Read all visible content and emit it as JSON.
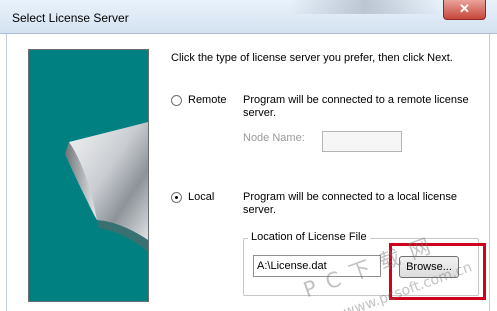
{
  "window": {
    "title": "Select License Server",
    "close_glyph": "✕"
  },
  "instruction": "Click the type of license server you prefer, then click Next.",
  "remote": {
    "label": "Remote",
    "checked": false,
    "description": "Program will be connected to a remote license server."
  },
  "node_name": {
    "label": "Node Name:",
    "value": ""
  },
  "local": {
    "label": "Local",
    "checked": true,
    "description": "Program will be connected to a local license server."
  },
  "license_file": {
    "group_label": "Location of License File",
    "value": "A:\\License.dat",
    "browse_label": "Browse..."
  },
  "watermark": {
    "title": "P C 下 载 网",
    "url": "www.pcsoft.com.cn"
  },
  "colors": {
    "side_panel": "#008080",
    "highlight": "#d0021b"
  },
  "icons": {
    "close": "close-icon",
    "page_curl": "page-curl-graphic"
  }
}
